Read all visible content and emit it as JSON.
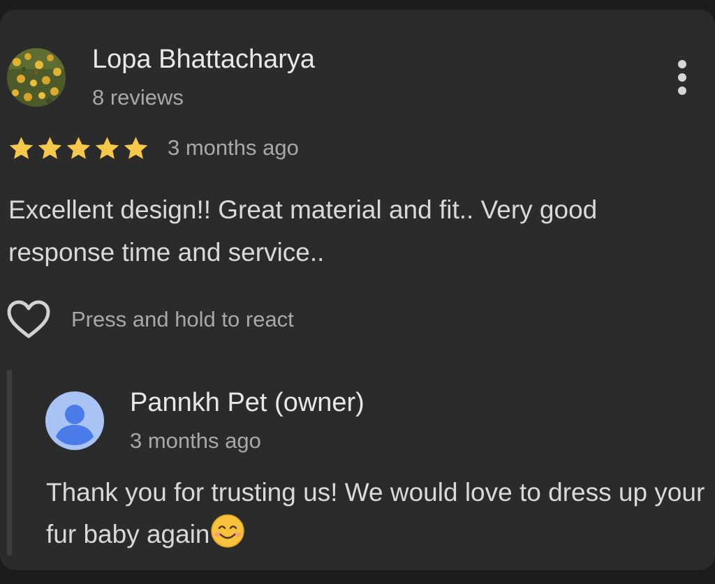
{
  "review": {
    "reviewer_name": "Lopa Bhattacharya",
    "reviewer_reviews": "8 reviews",
    "rating": 5,
    "rating_max": 5,
    "time": "3 months ago",
    "text": "Excellent design!! Great material and fit.. Very good response time and service..",
    "react_hint": "Press and hold to react"
  },
  "reply": {
    "owner_name": "Pannkh Pet (owner)",
    "time": "3 months ago",
    "text": "Thank you for trusting us! We would love to dress up your fur baby again",
    "emoji": "smiling-face-emoji"
  },
  "icons": {
    "more": "more-vertical-icon",
    "heart": "heart-outline-icon",
    "star": "star-icon",
    "owner_avatar": "person-avatar-icon"
  },
  "colors": {
    "card_background": "#2b2b2b",
    "page_background": "#1c1c1c",
    "star": "#f6c84a",
    "primary_text": "#e8e8e8",
    "secondary_text": "#a8a8a8",
    "avatar_accent": "#4b7be8"
  }
}
